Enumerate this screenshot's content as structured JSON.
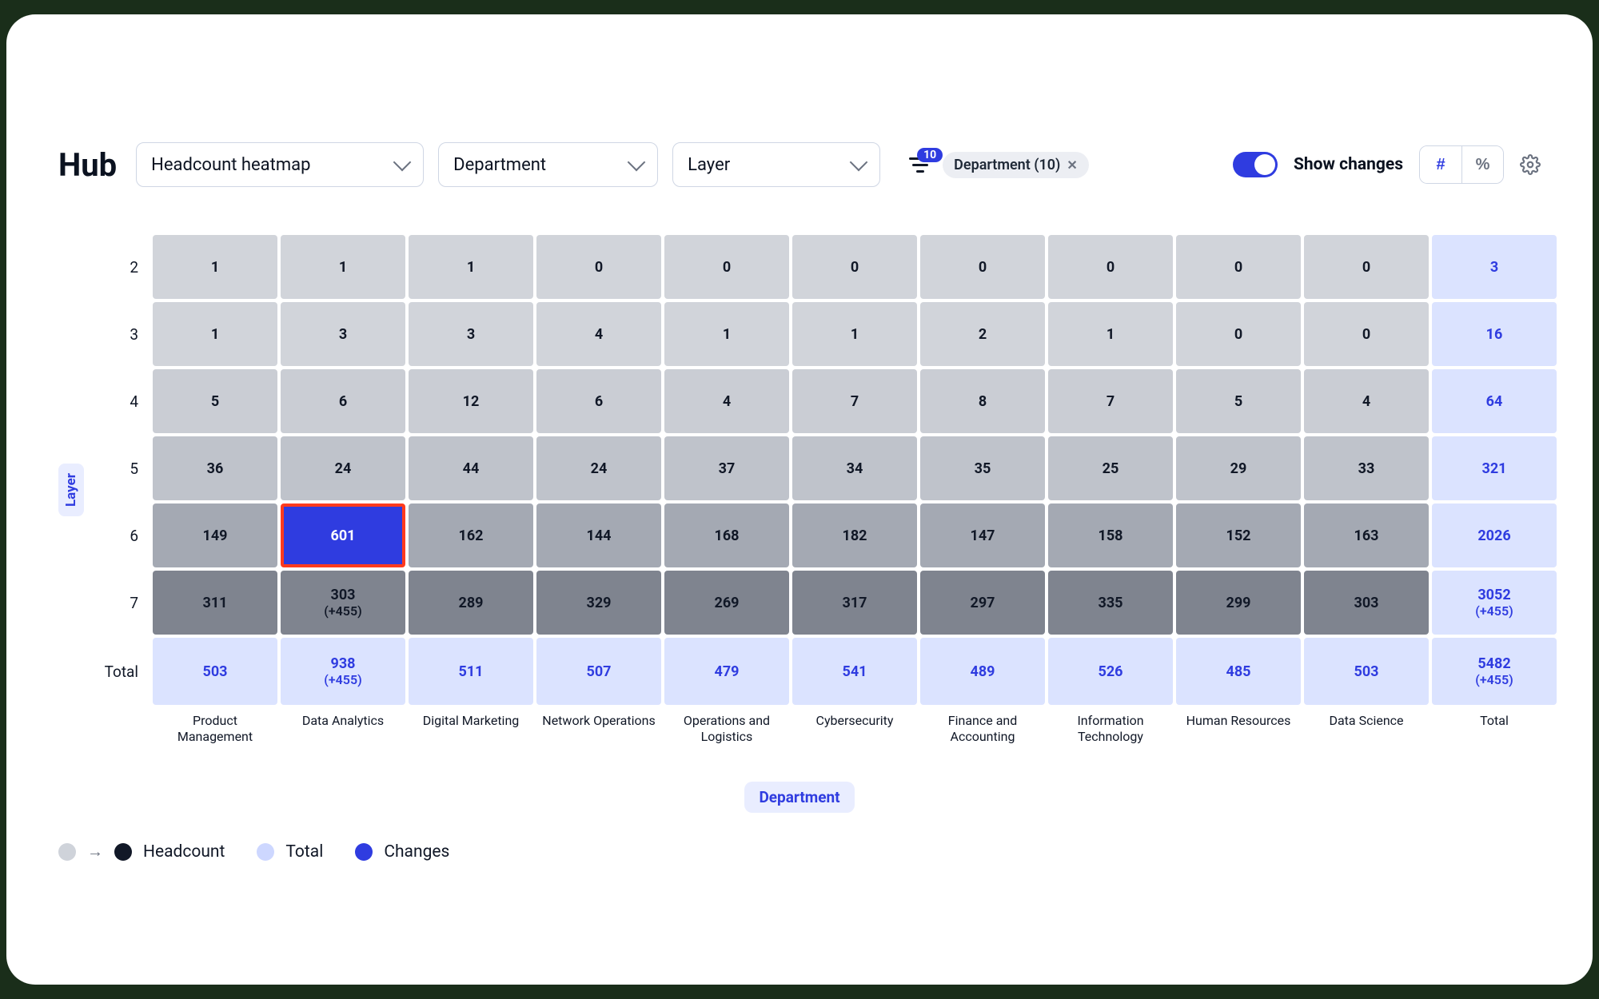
{
  "title": "Hub",
  "toolbar": {
    "metric_select": "Headcount heatmap",
    "x_select": "Department",
    "y_select": "Layer",
    "filter_count": "10",
    "filter_chip": "Department (10)",
    "show_changes_label": "Show changes",
    "seg_hash": "#",
    "seg_pct": "%"
  },
  "y_axis_label": "Layer",
  "x_axis_label": "Department",
  "legend": {
    "headcount": "Headcount",
    "total": "Total",
    "changes": "Changes"
  },
  "chart_data": {
    "type": "heatmap",
    "title": "Headcount heatmap",
    "xlabel": "Department",
    "ylabel": "Layer",
    "columns": [
      "Product Management",
      "Data Analytics",
      "Digital Marketing",
      "Network Operations",
      "Operations and Logistics",
      "Cybersecurity",
      "Finance and Accounting",
      "Information Technology",
      "Human Resources",
      "Data Science",
      "Total"
    ],
    "rows": [
      "2",
      "3",
      "4",
      "5",
      "6",
      "7",
      "Total"
    ],
    "values": [
      [
        1,
        1,
        1,
        0,
        0,
        0,
        0,
        0,
        0,
        0,
        3
      ],
      [
        1,
        3,
        3,
        4,
        1,
        1,
        2,
        1,
        0,
        0,
        16
      ],
      [
        5,
        6,
        12,
        6,
        4,
        7,
        8,
        7,
        5,
        4,
        64
      ],
      [
        36,
        24,
        44,
        24,
        37,
        34,
        35,
        25,
        29,
        33,
        321
      ],
      [
        149,
        601,
        162,
        144,
        168,
        182,
        147,
        158,
        152,
        163,
        2026
      ],
      [
        311,
        303,
        289,
        329,
        269,
        317,
        297,
        335,
        299,
        303,
        3052
      ],
      [
        503,
        938,
        511,
        507,
        479,
        541,
        489,
        526,
        485,
        503,
        5482
      ]
    ],
    "deltas": {
      "5,1": "+455",
      "5,10": "+455",
      "6,1": "+455",
      "6,10": "+455"
    },
    "highlight": [
      5,
      1
    ],
    "series": []
  }
}
